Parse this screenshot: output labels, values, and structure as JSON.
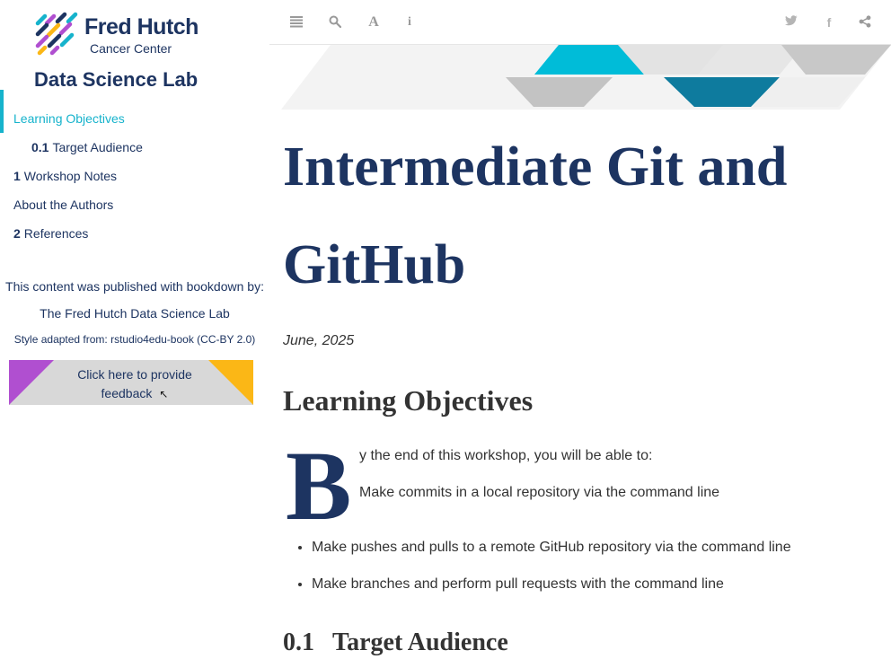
{
  "sidebar": {
    "logo": {
      "title": "Fred Hutch",
      "subtitle": "Cancer Center",
      "lab": "Data Science Lab"
    },
    "toc": [
      {
        "num": "",
        "label": "Learning Objectives",
        "active": true
      },
      {
        "num": "0.1",
        "label": "Target Audience"
      },
      {
        "num": "1",
        "label": "Workshop Notes"
      },
      {
        "num": "",
        "label": "About the Authors"
      },
      {
        "num": "2",
        "label": "References"
      }
    ],
    "published_by": "This content was published with bookdown by:",
    "lab_name": "The Fred Hutch Data Science Lab",
    "style_credit": "Style adapted from: rstudio4edu-book (CC-BY 2.0)",
    "feedback_label": "Click here to provide feedback"
  },
  "toolbar": {
    "left": [
      "menu-icon",
      "search-icon",
      "font-icon",
      "info-icon"
    ],
    "right": [
      "twitter-icon",
      "facebook-icon",
      "share-icon"
    ]
  },
  "main": {
    "title": "Intermediate Git and GitHub",
    "date": "June, 2025",
    "heading": "Learning Objectives",
    "dropcap": "B",
    "intro": "y the end of this workshop, you will be able to:",
    "first_item": "Make commits in a local repository via the command line",
    "bullets": [
      "Make pushes and pulls to a remote GitHub repository via the command line",
      "Make branches and perform pull requests with the command line"
    ],
    "section": {
      "num": "0.1",
      "title": "Target Audience"
    }
  },
  "colors": {
    "navy": "#1d3461",
    "teal": "#16b3cc",
    "purple": "#b04fd0",
    "gold": "#fbb716"
  }
}
